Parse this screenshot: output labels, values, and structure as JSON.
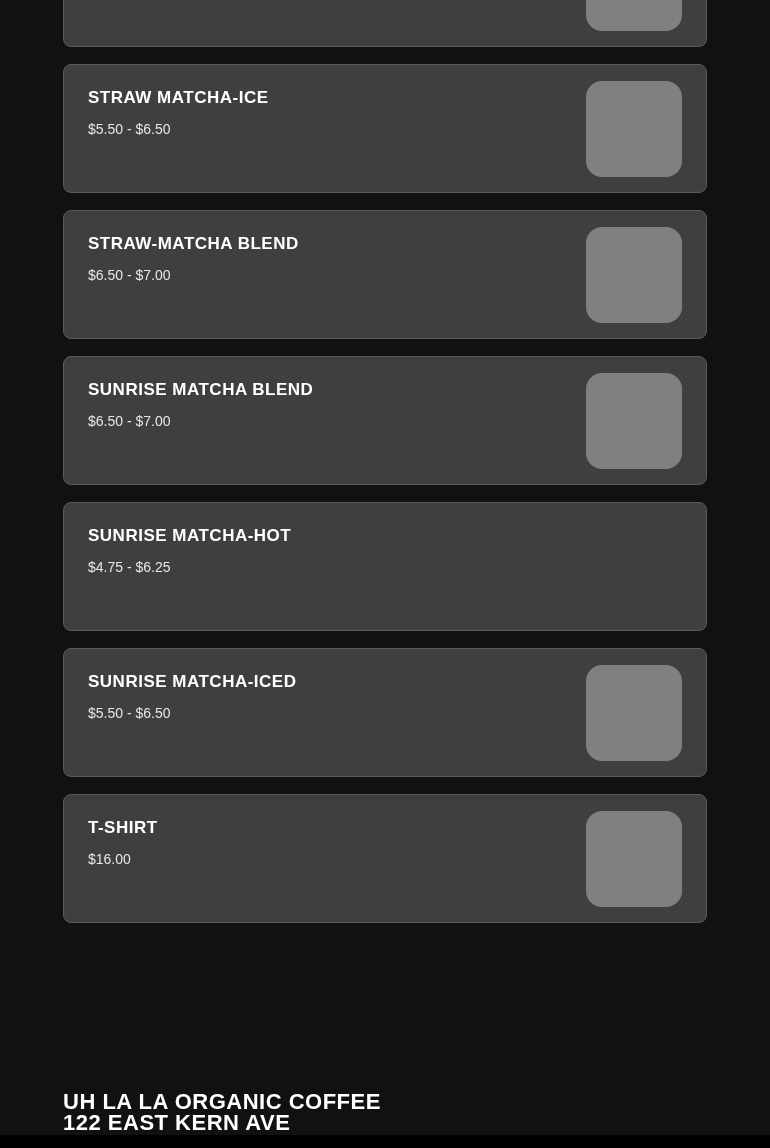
{
  "menu_items": [
    {
      "image": true
    },
    {
      "name": "STRAW MATCHA-ICE",
      "price": "$5.50 - $6.50",
      "image": true
    },
    {
      "name": "STRAW-MATCHA BLEND",
      "price": "$6.50 - $7.00",
      "image": true
    },
    {
      "name": "SUNRISE MATCHA BLEND",
      "price": "$6.50 - $7.00",
      "image": true
    },
    {
      "name": "SUNRISE MATCHA-HOT",
      "price": "$4.75 - $6.25",
      "image": false
    },
    {
      "name": "SUNRISE MATCHA-ICED",
      "price": "$5.50 - $6.50",
      "image": true
    },
    {
      "name": "T-SHIRT",
      "price": "$16.00",
      "image": true
    }
  ],
  "footer": {
    "lines": [
      "UH LA LA ORGANIC COFFEE",
      "122 EAST KERN AVE"
    ]
  }
}
